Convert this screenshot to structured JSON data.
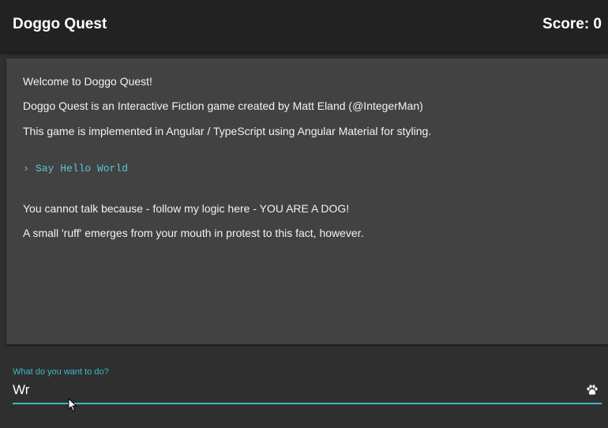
{
  "header": {
    "title": "Doggo Quest",
    "score_label": "Score: 0"
  },
  "story": {
    "lines_before": [
      "Welcome to Doggo Quest!",
      "Doggo Quest is an Interactive Fiction game created by Matt Eland (@IntegerMan)",
      "This game is implemented in Angular / TypeScript using Angular Material for styling."
    ],
    "command": {
      "prompt_glyph": "›",
      "text": "Say Hello World"
    },
    "lines_after": [
      "You cannot talk because - follow my logic here - YOU ARE A DOG!",
      "A small 'ruff' emerges from your mouth in protest to this fact, however."
    ]
  },
  "input": {
    "label": "What do you want to do?",
    "value": "Wr",
    "submit_icon": "paw-icon"
  },
  "colors": {
    "accent": "#3fb8c9",
    "toolbar": "#222222",
    "card": "#424242",
    "background": "#2f2f2f"
  }
}
